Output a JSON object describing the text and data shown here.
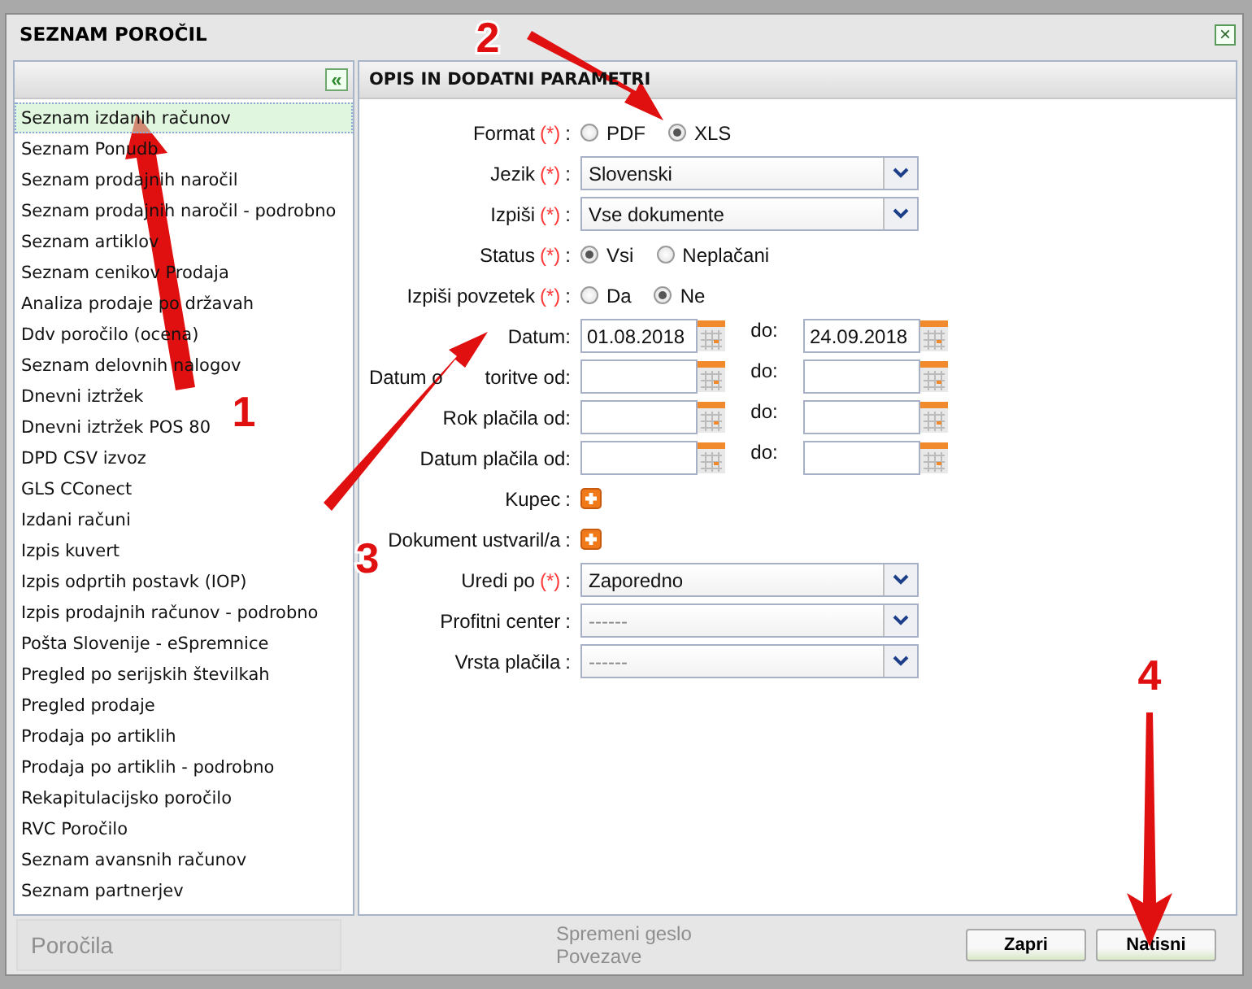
{
  "window": {
    "title": "SEZNAM POROČIL",
    "close": "×"
  },
  "background": {
    "texts": [
      "Poročila",
      "Spremeni geslo",
      "Povezave"
    ]
  },
  "list": {
    "collapse": "«",
    "items": [
      {
        "label": "Seznam izdanih računov",
        "selected": true
      },
      {
        "label": "Seznam Ponudb",
        "selected": false
      },
      {
        "label": "Seznam prodajnih naročil",
        "selected": false
      },
      {
        "label": "Seznam prodajnih naročil - podrobno",
        "selected": false
      },
      {
        "label": "Seznam artiklov",
        "selected": false
      },
      {
        "label": "Seznam cenikov Prodaja",
        "selected": false
      },
      {
        "label": "Analiza prodaje po državah",
        "selected": false
      },
      {
        "label": "Ddv poročilo (ocena)",
        "selected": false
      },
      {
        "label": "Seznam delovnih nalogov",
        "selected": false
      },
      {
        "label": "Dnevni iztržek",
        "selected": false
      },
      {
        "label": "Dnevni iztržek POS 80",
        "selected": false
      },
      {
        "label": "DPD CSV izvoz",
        "selected": false
      },
      {
        "label": "GLS CConect",
        "selected": false
      },
      {
        "label": "Izdani računi",
        "selected": false
      },
      {
        "label": "Izpis kuvert",
        "selected": false
      },
      {
        "label": "Izpis odprtih postavk (IOP)",
        "selected": false
      },
      {
        "label": "Izpis prodajnih računov - podrobno",
        "selected": false
      },
      {
        "label": "Pošta Slovenije - eSpremnice",
        "selected": false
      },
      {
        "label": "Pregled po serijskih številkah",
        "selected": false
      },
      {
        "label": "Pregled prodaje",
        "selected": false
      },
      {
        "label": "Prodaja po artiklih",
        "selected": false
      },
      {
        "label": "Prodaja po artiklih - podrobno",
        "selected": false
      },
      {
        "label": "Rekapitulacijsko poročilo",
        "selected": false
      },
      {
        "label": "RVC Poročilo",
        "selected": false
      },
      {
        "label": "Seznam avansnih računov",
        "selected": false
      },
      {
        "label": "Seznam partnerjev",
        "selected": false
      }
    ]
  },
  "form": {
    "title": "OPIS IN DODATNI PARAMETRI",
    "rows": [
      {
        "kind": "radio",
        "label": "Format",
        "required": "(*)",
        "colon": ":",
        "options": [
          {
            "label": "PDF",
            "selected": false
          },
          {
            "label": "XLS",
            "selected": true
          }
        ]
      },
      {
        "kind": "select",
        "label": "Jezik",
        "required": "(*)",
        "colon": ":",
        "value": "Slovenski"
      },
      {
        "kind": "select",
        "label": "Izpiši",
        "required": "(*)",
        "colon": ":",
        "value": "Vse dokumente"
      },
      {
        "kind": "radio",
        "label": "Status",
        "required": "(*)",
        "colon": ":",
        "options": [
          {
            "label": "Vsi",
            "selected": true
          },
          {
            "label": "Neplačani",
            "selected": false
          }
        ]
      },
      {
        "kind": "radio",
        "label": "Izpiši povzetek",
        "required": "(*)",
        "colon": ":",
        "options": [
          {
            "label": "Da",
            "selected": false
          },
          {
            "label": "Ne",
            "selected": true
          }
        ]
      },
      {
        "kind": "daterange",
        "label": "Datum:",
        "from": "01.08.2018",
        "to_label": "do:",
        "to": "24.09.2018"
      },
      {
        "kind": "daterange",
        "label": "Datum o",
        "label_rest": "toritve od:",
        "to_label": "do:"
      },
      {
        "kind": "daterange",
        "label": "Rok plačila od:",
        "to_label": "do:"
      },
      {
        "kind": "daterange",
        "label": "Datum plačila od:",
        "to_label": "do:"
      },
      {
        "kind": "add",
        "label": "Kupec",
        "colon": ":"
      },
      {
        "kind": "add",
        "label": "Dokument ustvaril/a",
        "colon": ":"
      },
      {
        "kind": "select",
        "label": "Uredi po",
        "required": "(*)",
        "colon": ":",
        "value": "Zaporedno"
      },
      {
        "kind": "select",
        "label": "Profitni center",
        "colon": ":",
        "value": "------"
      },
      {
        "kind": "select",
        "label": "Vrsta plačila",
        "colon": ":",
        "value": "------"
      }
    ]
  },
  "buttons": [
    {
      "label": "Zapri"
    },
    {
      "label": "Natisni"
    }
  ],
  "annotations": [
    {
      "label": "1"
    },
    {
      "label": "2"
    },
    {
      "label": "3"
    },
    {
      "label": "4"
    }
  ]
}
